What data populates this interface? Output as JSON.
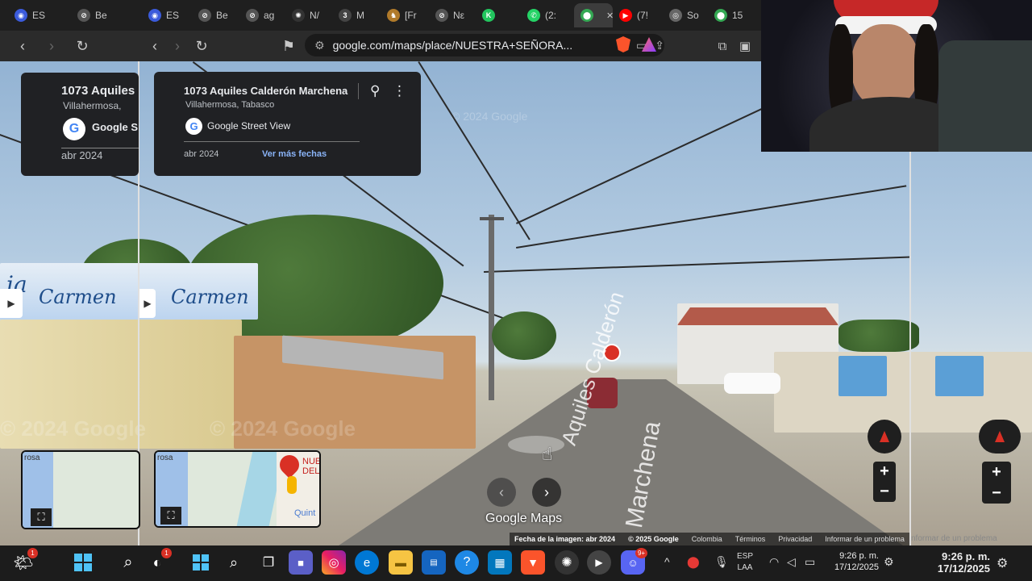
{
  "tabs": [
    {
      "label": "ES",
      "color": "#3b5bdb",
      "glyph": "◉"
    },
    {
      "label": "Be",
      "color": "#555",
      "glyph": "⊘"
    },
    {
      "label": "ES",
      "color": "#3b5bdb",
      "glyph": "◉"
    },
    {
      "label": "Be",
      "color": "#555",
      "glyph": "⊘"
    },
    {
      "label": "ag",
      "color": "#555",
      "glyph": "⊘"
    },
    {
      "label": "N/",
      "color": "#333",
      "glyph": "✺"
    },
    {
      "label": "M",
      "color": "#444",
      "glyph": "3"
    },
    {
      "label": "[Fr",
      "color": "#b07a2a",
      "glyph": "♞"
    },
    {
      "label": "Nε",
      "color": "#555",
      "glyph": "⊘"
    },
    {
      "label": "",
      "color": "#22c55e",
      "glyph": "K"
    },
    {
      "label": "(2:",
      "color": "#25d366",
      "glyph": "✆"
    },
    {
      "label": "",
      "color": "#34a853",
      "glyph": "⬤"
    },
    {
      "label": "(7!",
      "color": "#ff0000",
      "glyph": "▶"
    },
    {
      "label": "So",
      "color": "#666",
      "glyph": "◎"
    },
    {
      "label": "15",
      "color": "#34a853",
      "glyph": "⬤"
    }
  ],
  "url": "google.com/maps/place/NUESTRA+SEÑORA...",
  "card_main": {
    "title": "1073 Aquiles Calderón Marchena",
    "subtitle": "Villahermosa, Tabasco",
    "provider": "Google Street View",
    "date": "abr 2024",
    "more_dates": "Ver más fechas"
  },
  "card_ghost": {
    "title": "1073 Aquiles",
    "subtitle": "Villahermosa,",
    "provider": "Google S",
    "date": "abr 2024"
  },
  "storefront_sign": "Carmen",
  "storefront_sign_prefix": "ia",
  "map_label": "NUE DEL",
  "map_label_line1": "NUE",
  "map_label_line2": "DEL",
  "map_label_quint": "Quint",
  "map_label_rosa": "rosa",
  "watermark": "© 2024 Google",
  "road_text_1": "Aquiles Calderón",
  "road_text_2": "Marchena",
  "google_maps_logo": "Google Maps",
  "attribution": [
    "Fecha de la imagen: abr 2024",
    "© 2025 Google",
    "Colombia",
    "Términos",
    "Privacidad",
    "Informar de un problema"
  ],
  "attribution_ghost": "nformar de un problema",
  "zoom_in": "+",
  "zoom_out": "−",
  "taskbar": {
    "weather_badge": "1",
    "browser_badge": "1",
    "discord_badge": "9+",
    "lang": "ESP",
    "lang_sub": "LAA",
    "time": "9:26 p. m.",
    "date": "17/12/2025"
  }
}
